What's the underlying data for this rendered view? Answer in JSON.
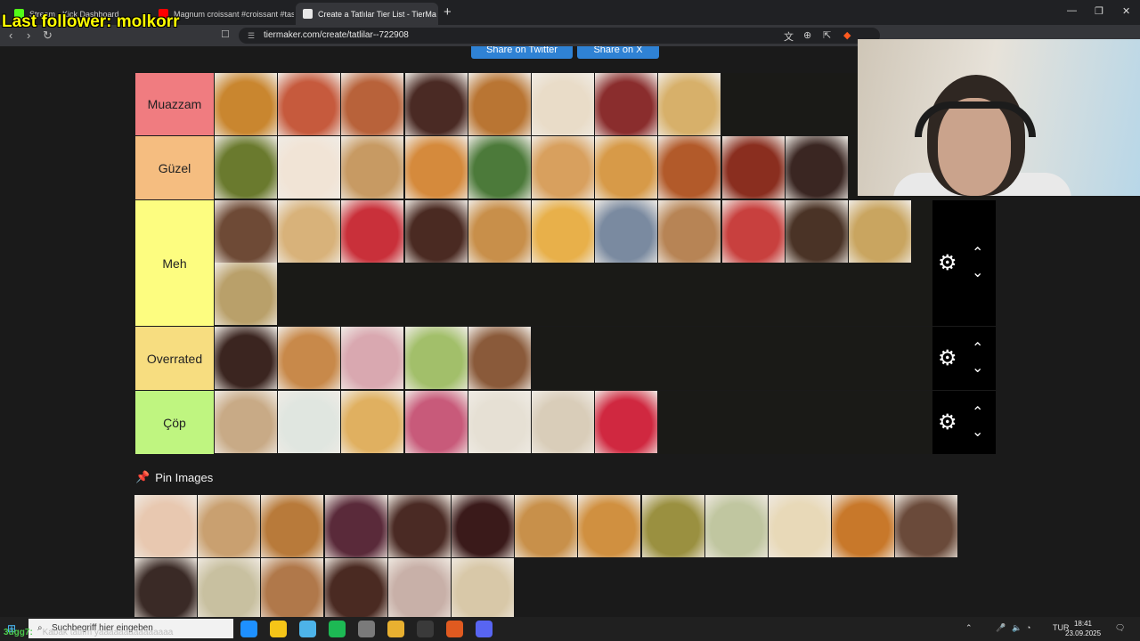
{
  "browser": {
    "tabs": [
      {
        "title": "Stream - Kick Dashboard",
        "favicon_color": "#53fc18",
        "active": false
      },
      {
        "title": "Magnum croissant #croissant #taste",
        "favicon_color": "#ff0000",
        "active": false
      },
      {
        "title": "Create a Tatlılar Tier List - TierMa",
        "favicon_color": "#e8e8e8",
        "active": true
      }
    ],
    "url": "tiermaker.com/create/tatlilar--722908",
    "new_tab_symbol": "+"
  },
  "stream_overlay": {
    "last_follower": "Last follower: molkorr"
  },
  "page": {
    "share_buttons": [
      "Share on Twitter",
      "Share on X"
    ],
    "tiers": [
      {
        "label": "Muazzam",
        "color": "#f07c80",
        "items": [
          "#c9862f",
          "#c65a3d",
          "#b8623a",
          "#4a2a24",
          "#b97533",
          "#e9dcc8",
          "#8a2d2d",
          "#d7b06a"
        ]
      },
      {
        "label": "Güzel",
        "color": "#f5bd80",
        "items": [
          "#6a7a2e",
          "#f1e4d6",
          "#c79a63",
          "#d58a3c",
          "#4c7a3a",
          "#d8a05e",
          "#d79a48",
          "#b25a2a",
          "#8a2e1f",
          "#3a2622"
        ]
      },
      {
        "label": "Meh",
        "color": "#fdfd80",
        "items": [
          "#6e4a36",
          "#d8b27a",
          "#c9303a",
          "#4a2a22",
          "#c88f4a",
          "#e8b04a",
          "#7a8aa0",
          "#b78455",
          "#c8403e",
          "#4a3326",
          "#c9a560",
          "#b9a06a"
        ]
      },
      {
        "label": "Overrated",
        "color": "#f7dd80",
        "items": [
          "#3b2520",
          "#c8894a",
          "#d9a8b0",
          "#a2bf6a",
          "#8a5a3a"
        ]
      },
      {
        "label": "Çöp",
        "color": "#bff580",
        "items": [
          "#c8aa86",
          "#e0e6e0",
          "#e0b060",
          "#c85a7a",
          "#e6e0d4",
          "#d9cdb9",
          "#d02840"
        ]
      }
    ],
    "pin_images_title": "Pin Images",
    "pin_images": [
      "#e8c8b0",
      "#c9a070",
      "#b87a3a",
      "#5a2a3a",
      "#4a2a24",
      "#3a1a1a",
      "#c8904a",
      "#d09040",
      "#9a9040",
      "#c0c6a0",
      "#e8d9b8",
      "#c8782a",
      "#6a4a3a",
      "#3a2a26",
      "#c8c0a0",
      "#b0784a",
      "#4a2a22",
      "#c8b0a8",
      "#d8c8a8"
    ]
  },
  "taskbar": {
    "ticker_user": "3ugg7:",
    "ticker_text": "Kabak tatlım yaaaaaaaaaaaaaaa",
    "search_placeholder": "Suchbegriff hier eingeben",
    "language": "TUR",
    "time": "18:41",
    "date": "23.09.2025",
    "apps": [
      "#1e90ff",
      "#f5c518",
      "#4db3e8",
      "#1db954",
      "#7a7a7a",
      "#e8b030",
      "#3a3a3a",
      "#e05a20",
      "#5865f2"
    ]
  }
}
